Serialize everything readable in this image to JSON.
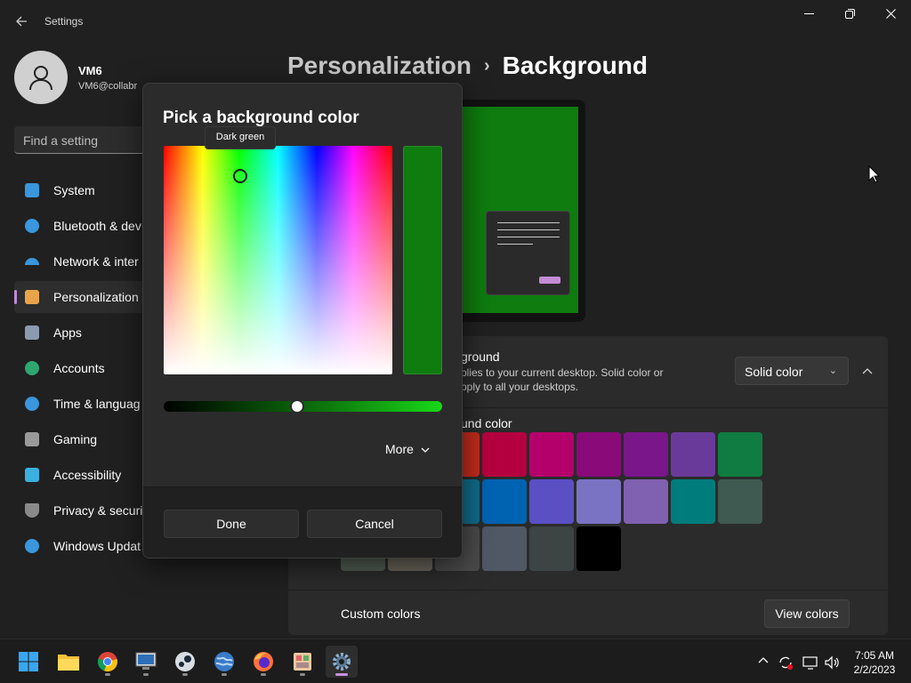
{
  "window": {
    "title": "Settings",
    "back_icon": "arrow-left-icon",
    "minimize_icon": "minimize-icon",
    "restore_icon": "restore-icon",
    "close_icon": "close-icon"
  },
  "user": {
    "name": "VM6",
    "email": "VM6@collabr"
  },
  "search": {
    "placeholder": "Find a setting"
  },
  "sidebar": {
    "items": [
      {
        "label": "System",
        "icon": "monitor-icon",
        "color": "#3a96dd"
      },
      {
        "label": "Bluetooth & dev",
        "icon": "bluetooth-icon",
        "color": "#3a96dd"
      },
      {
        "label": "Network & inter",
        "icon": "wifi-icon",
        "color": "#3a96dd"
      },
      {
        "label": "Personalization",
        "icon": "brush-icon",
        "color": "#e8a44a",
        "active": true
      },
      {
        "label": "Apps",
        "icon": "apps-icon",
        "color": "#8a9bb0"
      },
      {
        "label": "Accounts",
        "icon": "person-icon",
        "color": "#2ea66f"
      },
      {
        "label": "Time & languag",
        "icon": "clock-globe-icon",
        "color": "#3a96dd"
      },
      {
        "label": "Gaming",
        "icon": "gamepad-icon",
        "color": "#9a9a9a"
      },
      {
        "label": "Accessibility",
        "icon": "accessibility-icon",
        "color": "#3ab0e0"
      },
      {
        "label": "Privacy & securit",
        "icon": "shield-icon",
        "color": "#8a8a8a"
      },
      {
        "label": "Windows Updat",
        "icon": "update-icon",
        "color": "#3a96dd"
      }
    ]
  },
  "header": {
    "parent": "Personalization",
    "separator": "›",
    "current": "Background"
  },
  "panel": {
    "personalize_title": "ground",
    "personalize_desc_1": "plies to your current desktop. Solid color or",
    "personalize_desc_2": "pply to all your desktops.",
    "dropdown_value": "Solid color",
    "bgcolor_label": "und color",
    "custom_colors_label": "Custom colors",
    "view_colors_label": "View colors",
    "swatch_colors": [
      "#c42b1c",
      "#b4003e",
      "#b4006a",
      "#8a0a7a",
      "#7a168a",
      "#6a3a9a",
      "#107c41",
      "#0f6c8a",
      "#0063b1",
      "#5b4fc4",
      "#7a73c4",
      "#8060b0",
      "#007c7c",
      "#3f5a50",
      "#525e54",
      "#6a665a",
      "#4a4a4a",
      "#505866",
      "#3c4444",
      "#000000"
    ]
  },
  "dialog": {
    "title": "Pick a background color",
    "tooltip": "Dark green",
    "selected_color": "#0e7c0e",
    "value_level": 0.48,
    "more_label": "More",
    "done_label": "Done",
    "cancel_label": "Cancel"
  },
  "taskbar": {
    "apps": [
      "start-icon",
      "file-explorer-icon",
      "chrome-icon",
      "remote-desktop-icon",
      "steam-icon",
      "globe-app-icon",
      "firefox-icon",
      "app-icon",
      "settings-icon"
    ],
    "time": "7:05 AM",
    "date": "2/2/2023"
  }
}
